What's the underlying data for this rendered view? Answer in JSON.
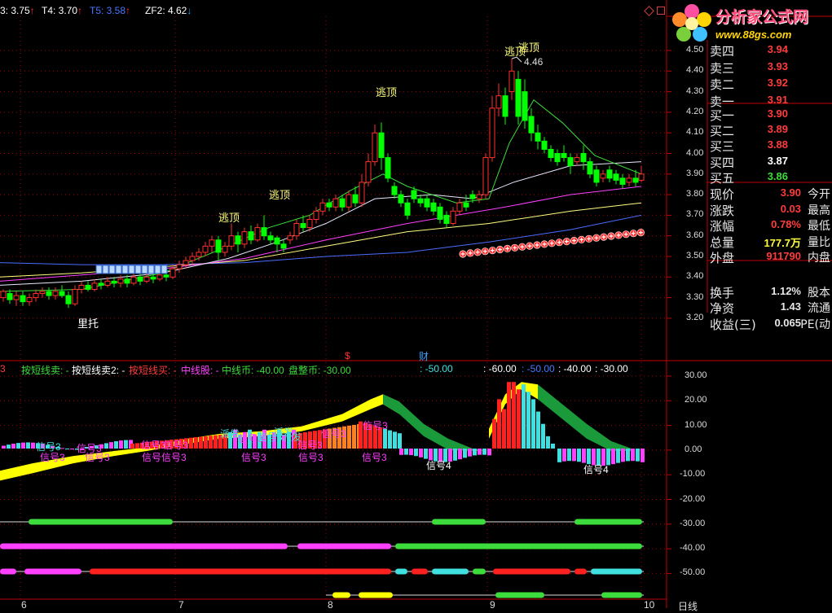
{
  "top_bar": {
    "items": [
      {
        "text": "3: 3.75",
        "arrow": "↑",
        "color": "#ffffff",
        "arrow_color": "#ff3030"
      },
      {
        "text": "T4: 3.70",
        "arrow": "↑",
        "color": "#ffffff",
        "arrow_color": "#ff3030"
      },
      {
        "text": "T5: 3.58",
        "arrow": "↑",
        "color": "#4a78ff",
        "arrow_color": "#ff3030"
      },
      {
        "text": "ZF2: 4.62",
        "arrow": "↓",
        "color": "#ffffff",
        "arrow_color": "#20a0ff"
      }
    ]
  },
  "logo": {
    "title": "分析家公式网",
    "url": "www.88gs.com"
  },
  "annotations": {
    "escape_top": "逃顶",
    "support": "里托",
    "high_value": "4.46",
    "marker_dollar": "$",
    "marker_finance": "财"
  },
  "price_axis": [
    "4.50",
    "4.40",
    "4.30",
    "4.20",
    "4.10",
    "4.00",
    "3.90",
    "3.80",
    "3.70",
    "3.60",
    "3.50",
    "3.40",
    "3.30",
    "3.20"
  ],
  "quote_panel": {
    "asks": [
      {
        "label": "卖四",
        "value": "3.94",
        "color": "#ff3c3c"
      },
      {
        "label": "卖三",
        "value": "3.93",
        "color": "#ff3c3c"
      },
      {
        "label": "卖二",
        "value": "3.92",
        "color": "#ff3c3c"
      },
      {
        "label": "卖一",
        "value": "3.91",
        "color": "#ff3c3c"
      }
    ],
    "bids": [
      {
        "label": "买一",
        "value": "3.90",
        "color": "#ff3c3c"
      },
      {
        "label": "买二",
        "value": "3.89",
        "color": "#ff3c3c"
      },
      {
        "label": "买三",
        "value": "3.88",
        "color": "#ff3c3c"
      },
      {
        "label": "买四",
        "value": "3.87",
        "color": "#ffffff"
      },
      {
        "label": "买五",
        "value": "3.86",
        "color": "#3cdc3c"
      }
    ],
    "stats": [
      {
        "label": "现价",
        "value": "3.90",
        "tail": "今开",
        "color": "#ff3c3c"
      },
      {
        "label": "涨跌",
        "value": "0.03",
        "tail": "最高",
        "color": "#ff3c3c"
      },
      {
        "label": "涨幅",
        "value": "0.78%",
        "tail": "最低",
        "color": "#ff3c3c"
      },
      {
        "label": "总量",
        "value": "177.7万",
        "tail": "量比",
        "color": "#ffff40"
      },
      {
        "label": "外盘",
        "value": "911790",
        "tail": "内盘",
        "color": "#ff3c3c"
      },
      {
        "label": "换手",
        "value": "1.12%",
        "tail": "股本",
        "color": "#e8e8e8"
      },
      {
        "label": "净资",
        "value": "1.43",
        "tail": "流通",
        "color": "#e8e8e8"
      },
      {
        "label": "收益(三)",
        "value": "0.065",
        "tail": "PE(动",
        "color": "#e8e8e8"
      }
    ]
  },
  "indicator_bar": {
    "items": [
      {
        "text": "3",
        "color": "#ff3c3c"
      },
      {
        "text": "按短线卖: -",
        "color": "#3cdc3c"
      },
      {
        "text": "按短线卖2: -",
        "color": "#ffffff"
      },
      {
        "text": "按短线买: -",
        "color": "#ff3c3c"
      },
      {
        "text": "中线股: -",
        "color": "#ff40ff"
      },
      {
        "text": "中线币: -40.00",
        "color": "#3cdc3c"
      },
      {
        "text": "盘整币: -30.00",
        "color": "#3cdc3c"
      },
      {
        "text": ": -50.00",
        "color": "#40e0e0"
      },
      {
        "text": ": -60.00",
        "color": "#ffffff"
      },
      {
        "text": ": -50.00",
        "color": "#4a78ff"
      },
      {
        "text": ": -40.00",
        "color": "#ffffff"
      },
      {
        "text": ": -30.00",
        "color": "#ffffff"
      }
    ]
  },
  "indicator_axis": [
    "30.00",
    "20.00",
    "10.00",
    "0.00",
    "-10.00",
    "-20.00",
    "-30.00",
    "-40.00",
    "-50.00"
  ],
  "signals": {
    "signal3": "信号3",
    "signal4": "信号4",
    "dispatch": "派发",
    "signal": "信号"
  },
  "date_axis": [
    "6",
    "7",
    "8",
    "9",
    "10"
  ],
  "period_label": "日线",
  "colors": {
    "up": "#ff3030",
    "down": "#00ff00",
    "grid": "#a00000",
    "cyan": "#40e0e0",
    "magenta": "#ff40ff",
    "yellow": "#ffff00"
  }
}
